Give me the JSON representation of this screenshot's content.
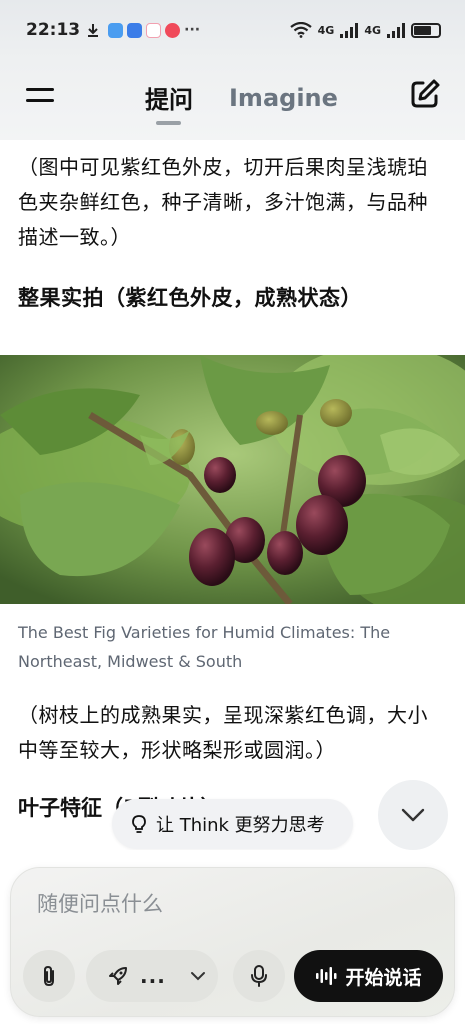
{
  "status_bar": {
    "time": "22:13",
    "more": "···",
    "network_1": "4G",
    "network_2": "4G"
  },
  "header": {
    "tabs": [
      {
        "label": "提问",
        "active": true
      },
      {
        "label": "Imagine",
        "active": false
      }
    ]
  },
  "content": {
    "paragraph_1": "（图中可见紫红色外皮，切开后果肉呈浅琥珀色夹杂鲜红色，种子清晰，多汁饱满，与品种描述一致。）",
    "heading_1": "整果实拍（紫红色外皮，成熟状态）",
    "image_caption": "The Best Fig Varieties for Humid Climates: The Northeast, Midwest & South",
    "paragraph_2": "（树枝上的成熟果实，呈现深紫红色调，大小中等至较大，形状略梨形或圆润。）",
    "heading_2": "叶子特征（5裂叶片）"
  },
  "think_chip": {
    "label": "让 Think 更努力思考"
  },
  "composer": {
    "placeholder": "随便问点什么",
    "model_label": "...",
    "speak_label": "开始说话"
  },
  "colors": {
    "accent_dark": "#111111",
    "muted_tab": "#6b7580",
    "caption": "#5f6773"
  }
}
